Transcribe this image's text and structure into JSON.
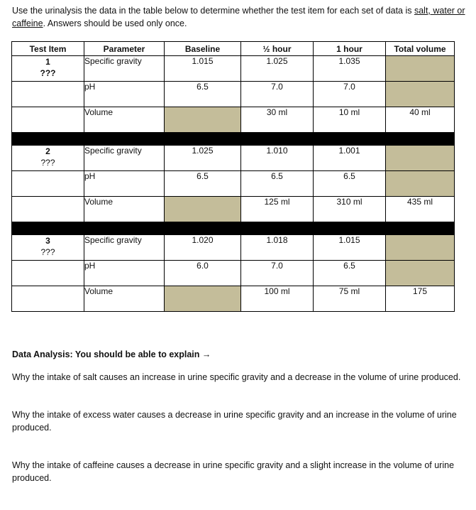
{
  "intro": {
    "text_before": "Use the urinalysis the data in the table below to determine whether the test item for each set of data is ",
    "underlined": "salt, water or caffeine",
    "text_after": ".  Answers should be used only once."
  },
  "table": {
    "headers": [
      "Test Item",
      "Parameter",
      "Baseline",
      "½ hour",
      "1 hour",
      "Total volume"
    ],
    "items": [
      {
        "number": "1",
        "label": "???",
        "rows": [
          {
            "parameter": "Specific gravity",
            "baseline": "1.015",
            "half_hour": "1.025",
            "one_hour": "1.035",
            "total": ""
          },
          {
            "parameter": "pH",
            "baseline": "6.5",
            "half_hour": "7.0",
            "one_hour": "7.0",
            "total": ""
          },
          {
            "parameter": "Volume",
            "baseline": "",
            "half_hour": "30 ml",
            "one_hour": "10 ml",
            "total": "40 ml"
          }
        ]
      },
      {
        "number": "2",
        "label": "???",
        "rows": [
          {
            "parameter": "Specific gravity",
            "baseline": "1.025",
            "half_hour": "1.010",
            "one_hour": "1.001",
            "total": ""
          },
          {
            "parameter": "pH",
            "baseline": "6.5",
            "half_hour": "6.5",
            "one_hour": "6.5",
            "total": ""
          },
          {
            "parameter": "Volume",
            "baseline": "",
            "half_hour": "125 ml",
            "one_hour": "310 ml",
            "total": "435 ml"
          }
        ]
      },
      {
        "number": "3",
        "label": "???",
        "rows": [
          {
            "parameter": "Specific gravity",
            "baseline": "1.020",
            "half_hour": "1.018",
            "one_hour": "1.015",
            "total": ""
          },
          {
            "parameter": "pH",
            "baseline": "6.0",
            "half_hour": "7.0",
            "one_hour": "6.5",
            "total": ""
          },
          {
            "parameter": "Volume",
            "baseline": "",
            "half_hour": "100 ml",
            "one_hour": "75 ml",
            "total": "175"
          }
        ]
      }
    ],
    "shade_color": "#c4bd9a"
  },
  "analysis": {
    "heading": "Data Analysis:  You should be able to explain →",
    "questions": [
      "Why the intake of salt causes an increase in urine specific gravity and a decrease in the volume of urine produced.",
      "Why the intake of excess water causes a decrease in urine specific gravity and an increase in the volume of urine produced.",
      "Why the intake of caffeine causes a decrease in urine specific gravity and a slight increase in the volume of urine produced."
    ]
  }
}
